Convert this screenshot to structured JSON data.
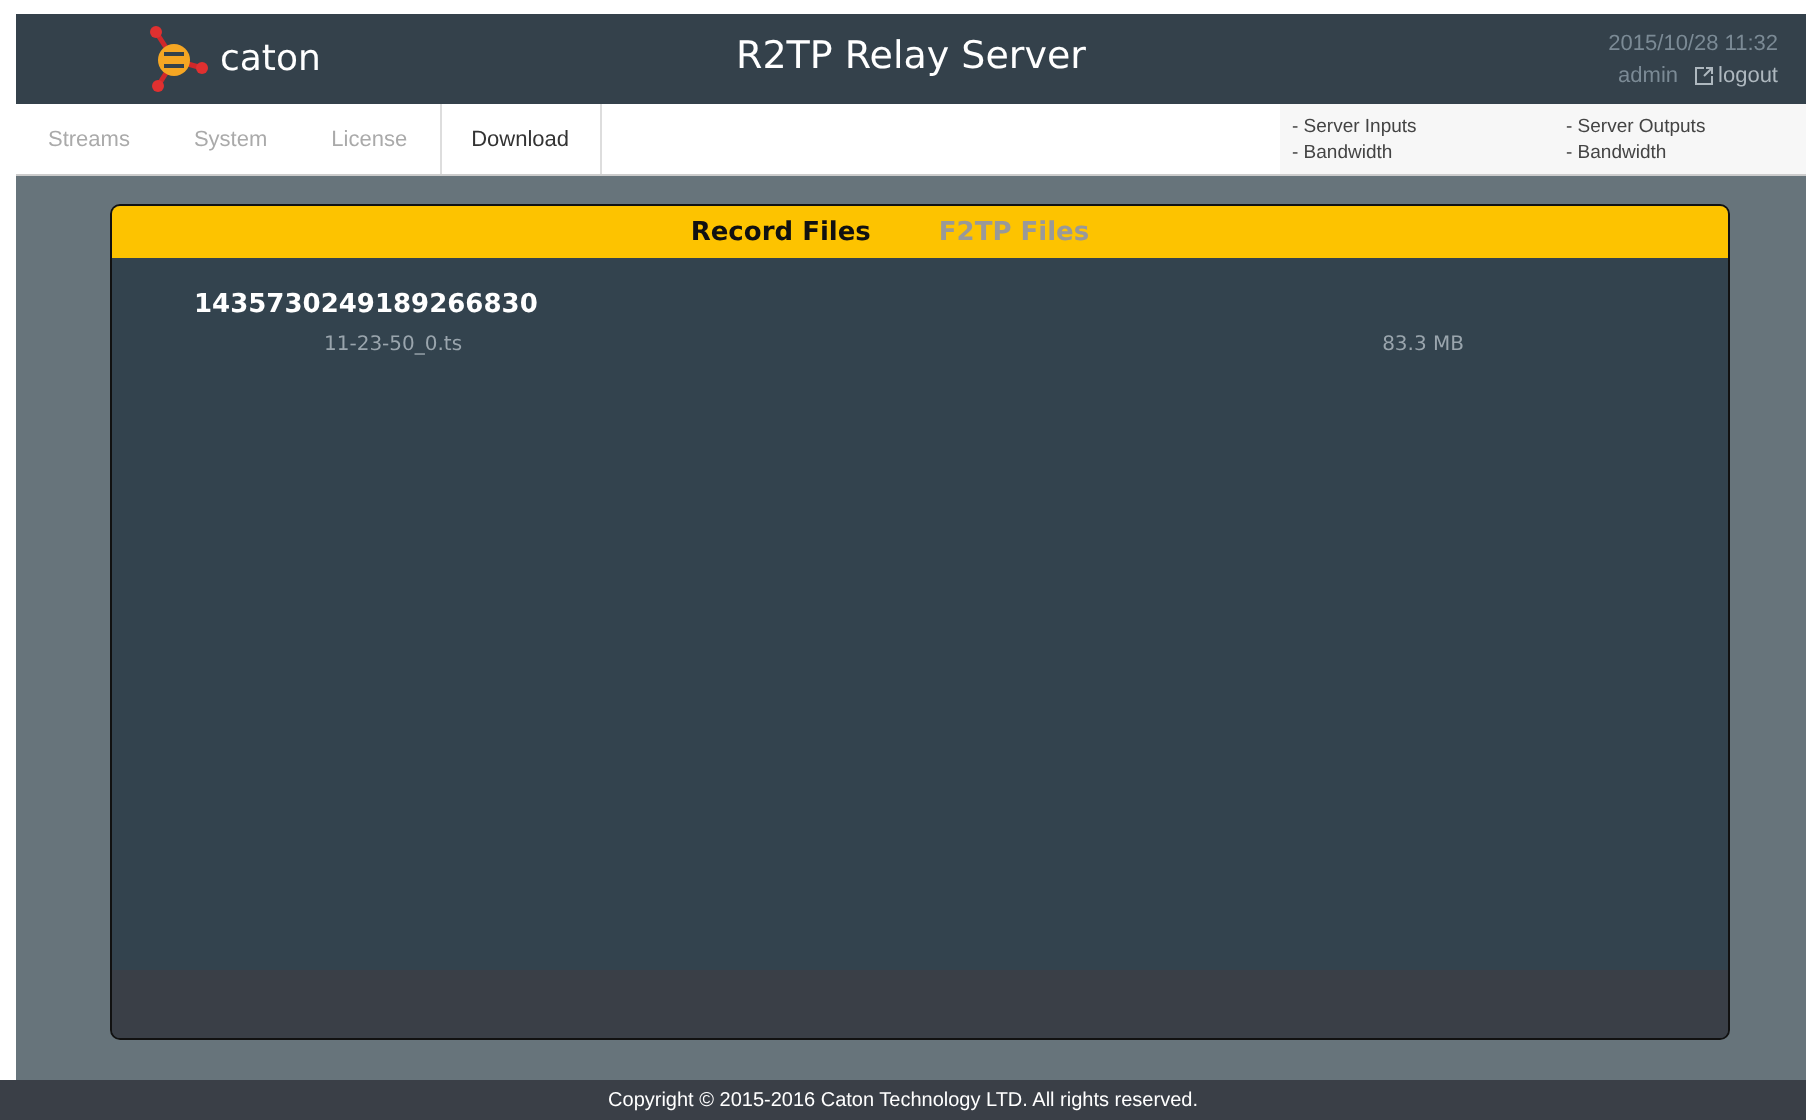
{
  "header": {
    "brand": "caton",
    "title": "R2TP Relay Server",
    "datetime": "2015/10/28 11:32",
    "user": "admin",
    "logout": "logout"
  },
  "nav": [
    {
      "label": "Streams",
      "selected": false
    },
    {
      "label": "System",
      "selected": false
    },
    {
      "label": "License",
      "selected": false
    },
    {
      "label": "Download",
      "selected": true
    }
  ],
  "stats": [
    "- Server Inputs",
    "- Bandwidth",
    "- Server Outputs",
    "- Bandwidth"
  ],
  "tabs": [
    {
      "label": "Record Files",
      "selected": true
    },
    {
      "label": "F2TP Files",
      "selected": false
    }
  ],
  "groups": [
    {
      "name": "1435730249189266830",
      "files": [
        {
          "name": "11-23-50_0.ts",
          "size": "83.3 MB"
        }
      ]
    }
  ],
  "footer": "Copyright © 2015-2016 Caton Technology LTD. All rights reserved."
}
